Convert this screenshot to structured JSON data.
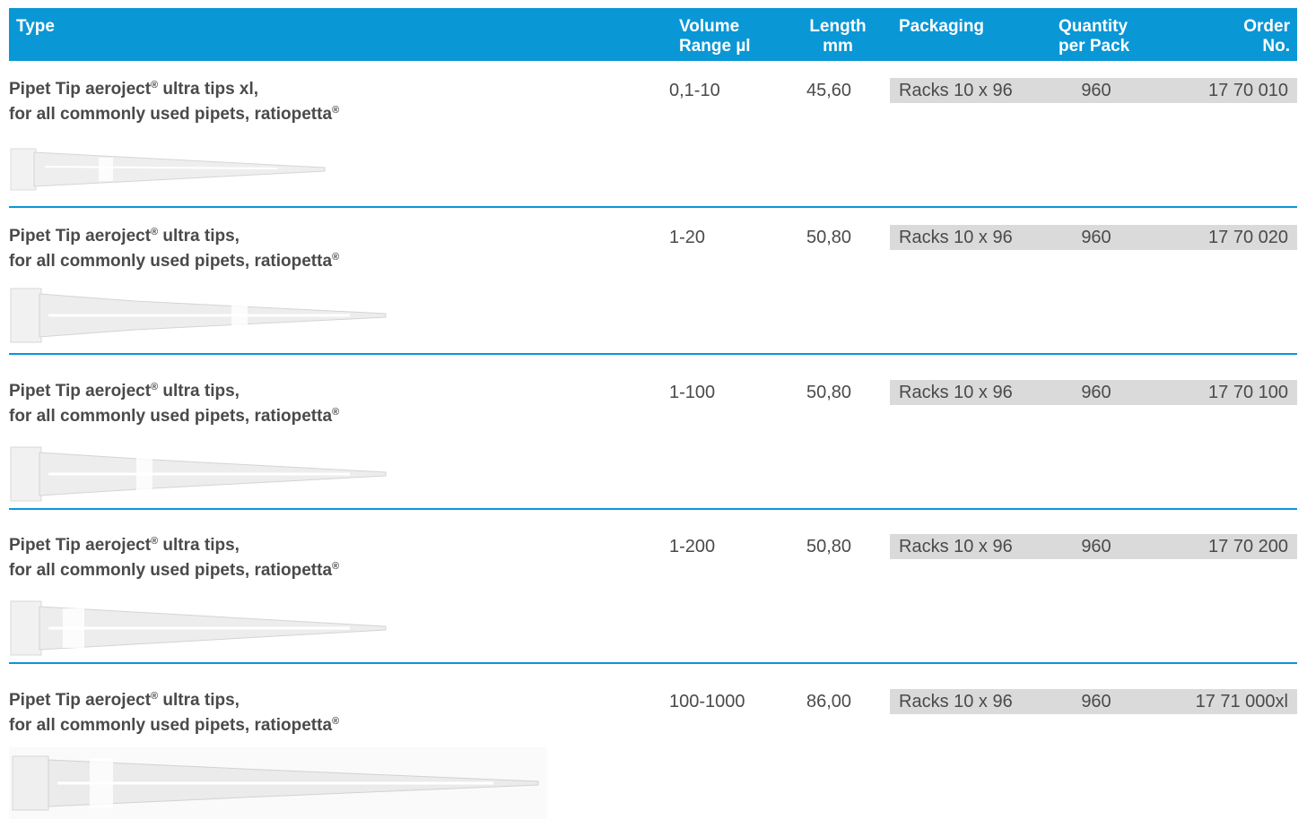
{
  "header": {
    "type": "Type",
    "volume_line1": "Volume",
    "volume_line2": "Range µl",
    "length_line1": "Length",
    "length_line2": "mm",
    "packaging": "Packaging",
    "quantity_line1": "Quantity",
    "quantity_line2": "per Pack",
    "order_line1": "Order",
    "order_line2": "No."
  },
  "rows": [
    {
      "name_part1": "Pipet Tip aeroject",
      "name_part2": " ultra tips xl,",
      "name_line2": "for all commonly used pipets, ratiopetta",
      "registered": "®",
      "volume": "0,1-10",
      "length": "45,60",
      "packaging": "Racks 10 x 96",
      "quantity": "960",
      "order_no": "17 70 010"
    },
    {
      "name_part1": "Pipet Tip aeroject",
      "name_part2": " ultra tips,",
      "name_line2": "for all commonly used pipets, ratiopetta",
      "registered": "®",
      "volume": "1-20",
      "length": "50,80",
      "packaging": "Racks 10 x 96",
      "quantity": "960",
      "order_no": "17 70 020"
    },
    {
      "name_part1": "Pipet Tip aeroject",
      "name_part2": " ultra tips,",
      "name_line2": "for all commonly used pipets, ratiopetta",
      "registered": "®",
      "volume": "1-100",
      "length": "50,80",
      "packaging": "Racks 10 x 96",
      "quantity": "960",
      "order_no": "17 70 100"
    },
    {
      "name_part1": "Pipet Tip aeroject",
      "name_part2": " ultra tips,",
      "name_line2": "for all commonly used pipets, ratiopetta",
      "registered": "®",
      "volume": "1-200",
      "length": "50,80",
      "packaging": "Racks 10 x 96",
      "quantity": "960",
      "order_no": "17 70 200"
    },
    {
      "name_part1": "Pipet Tip aeroject",
      "name_part2": " ultra tips,",
      "name_line2": "for all commonly used pipets, ratiopetta",
      "registered": "®",
      "volume": "100-1000",
      "length": "86,00",
      "packaging": "Racks 10 x 96",
      "quantity": "960",
      "order_no": "17 71 000xl"
    }
  ],
  "colors": {
    "header_bg": "#0a97d6",
    "divider": "#0a97d6",
    "greybar": "#dadada",
    "text": "#4a4a4a"
  }
}
